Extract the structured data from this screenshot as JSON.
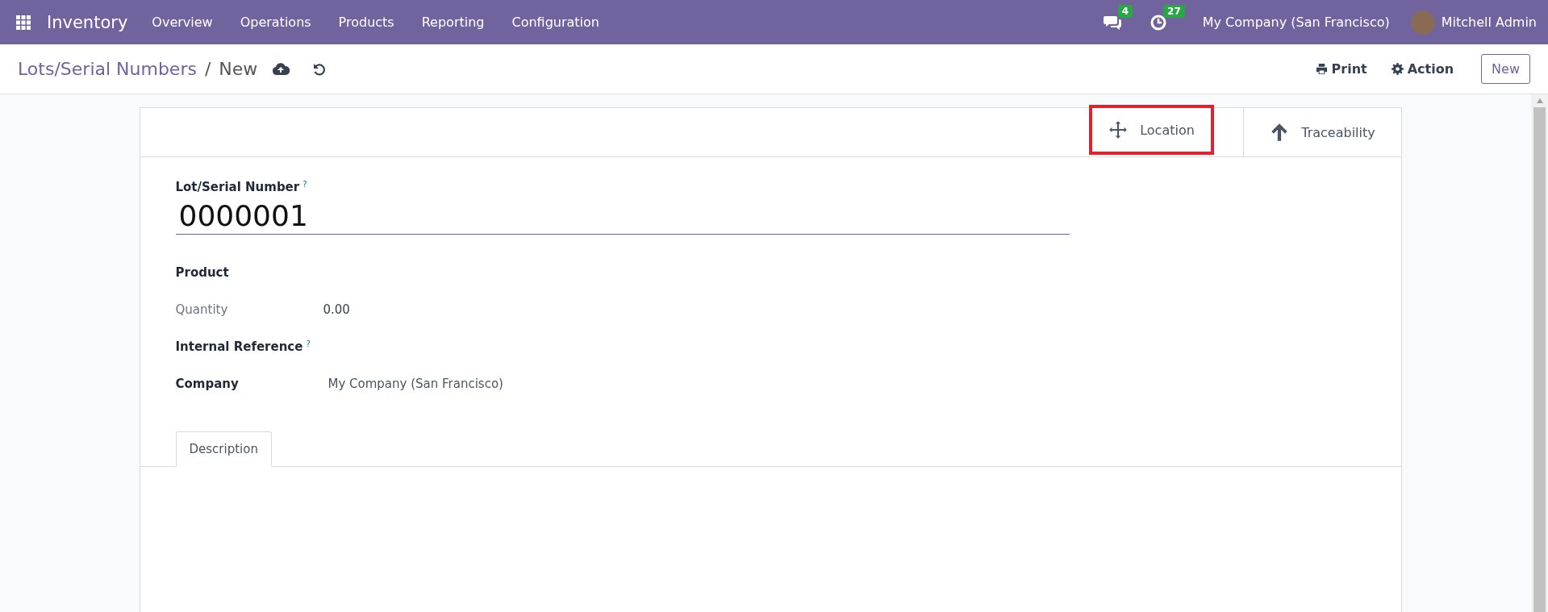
{
  "navbar": {
    "app": "Inventory",
    "menu": [
      "Overview",
      "Operations",
      "Products",
      "Reporting",
      "Configuration"
    ],
    "messages_count": "4",
    "activities_count": "27",
    "company": "My Company (San Francisco)",
    "user": "Mitchell Admin"
  },
  "control_panel": {
    "breadcrumb": "Lots/Serial Numbers",
    "separator": "/",
    "current": "New",
    "actions": [
      {
        "kind": "print",
        "label": "Print"
      },
      {
        "kind": "gear",
        "label": "Action"
      }
    ],
    "new_button": "New"
  },
  "button_box": [
    {
      "kind": "move",
      "label": "Location",
      "highlighted": true
    },
    {
      "kind": "up",
      "label": "Traceability",
      "highlighted": false
    }
  ],
  "form": {
    "name_label": "Lot/Serial Number",
    "name_help": "?",
    "name_value": "0000001",
    "fields": [
      {
        "kind": "bold",
        "label": "Product"
      },
      {
        "kind": "muted",
        "label": "Quantity",
        "value": "0.00"
      },
      {
        "kind": "bold",
        "label": "Internal Reference",
        "help": "?"
      },
      {
        "kind": "bold",
        "label": "Company",
        "value": "My Company (San Francisco)"
      }
    ],
    "tabs": [
      {
        "label": "Description",
        "selected": true
      }
    ]
  }
}
